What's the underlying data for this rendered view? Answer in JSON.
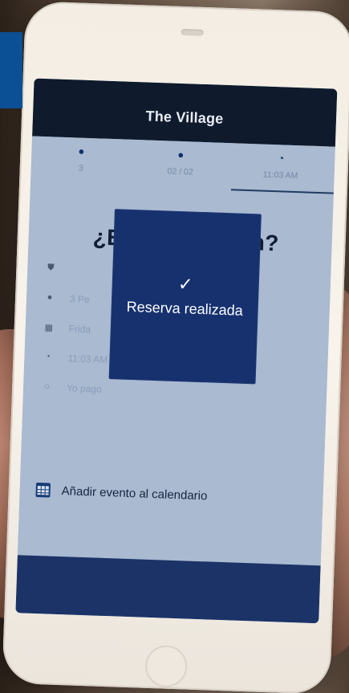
{
  "app": {
    "title": "The Village"
  },
  "tabs": [
    {
      "icon": "person-icon",
      "label": "3"
    },
    {
      "icon": "person-icon",
      "label": "02 / 02"
    },
    {
      "icon": "clock-icon",
      "label": "11:03 AM"
    }
  ],
  "content": {
    "question": "¿Está todo bien?",
    "details": [
      {
        "icon": "shield-icon",
        "text": ""
      },
      {
        "icon": "person-icon",
        "text": "3 Pe"
      },
      {
        "icon": "calendar-icon",
        "text": "Frida"
      },
      {
        "icon": "clock-icon",
        "text": "11:03 AM"
      },
      {
        "icon": "payment-icon",
        "text": "Yo pago"
      }
    ],
    "calendar_link": "Añadir evento al calendario"
  },
  "overlay": {
    "check_icon": "check-icon",
    "message": "Reserva realizada"
  }
}
